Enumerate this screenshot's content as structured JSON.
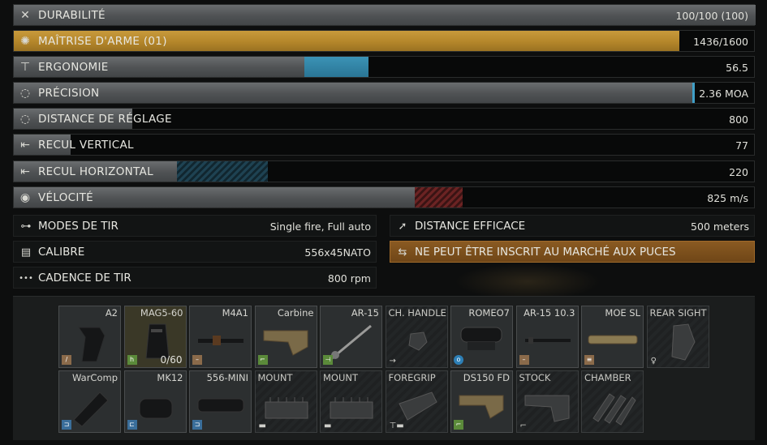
{
  "stats": [
    {
      "key": "durability",
      "icon": "wrench-icon",
      "glyph": "✕",
      "label": "DURABILITÉ",
      "value": "100/100 (100)",
      "fill": 1.0
    },
    {
      "key": "mastery",
      "icon": "laurel-icon",
      "glyph": "✺",
      "label": "MAÎTRISE D'ARME (01)",
      "value": "1436/1600",
      "fill": 0.8975
    },
    {
      "key": "ergonomics",
      "icon": "hand-icon",
      "glyph": "⊤",
      "label": "ERGONOMIE",
      "value": "56.5",
      "fill": 0.478,
      "delta": 0.086
    },
    {
      "key": "accuracy",
      "icon": "crosshair-icon",
      "glyph": "◌",
      "label": "PRÉCISION",
      "value": "2.36 MOA",
      "fill": 0.915
    },
    {
      "key": "sighting_range",
      "icon": "crosshair-icon",
      "glyph": "◌",
      "label": "DISTANCE DE RÉGLAGE",
      "value": "800",
      "fill": 0.16
    },
    {
      "key": "recoil_vertical",
      "icon": "recoil-icon",
      "glyph": "⇤",
      "label": "RECUL VERTICAL",
      "value": "77",
      "fill": 0.077
    },
    {
      "key": "recoil_horizontal",
      "icon": "recoil-icon",
      "glyph": "⇤",
      "label": "RECUL HORIZONTAL",
      "value": "220",
      "fill": 0.22,
      "delta_stripe": 0.122
    },
    {
      "key": "velocity",
      "icon": "muzzle-icon",
      "glyph": "◉",
      "label": "VÉLOCITÉ",
      "value": "825 m/s",
      "fill": 0.552,
      "delta_red": 0.065
    }
  ],
  "info": {
    "fire_modes": {
      "label": "MODES DE TIR",
      "value": "Single fire, Full auto",
      "glyph": "⊶"
    },
    "caliber": {
      "label": "CALIBRE",
      "value": "556x45NATO",
      "glyph": "▤"
    },
    "fire_rate": {
      "label": "CADENCE DE TIR",
      "value": "800 rpm",
      "glyph": "•••"
    },
    "effective_distance": {
      "label": "DISTANCE EFFICACE",
      "value": "500 meters",
      "glyph": "➚"
    },
    "flea_market": {
      "label": "NE PEUT ÊTRE INSCRIT AU MARCHÉ AUX PUCES",
      "glyph": "⇆"
    }
  },
  "mods_row1": [
    {
      "name": "A2",
      "badge": "brown",
      "btxt": "/"
    },
    {
      "name": "MAG5-60",
      "badge": "green",
      "btxt": "h",
      "count": "0/60",
      "tan": true
    },
    {
      "name": "M4A1",
      "badge": "brown",
      "btxt": "–"
    },
    {
      "name": "Carbine",
      "badge": "green",
      "btxt": "⌐"
    },
    {
      "name": "AR-15",
      "badge": "green",
      "btxt": "⊣"
    },
    {
      "name": "CH. HANDLE",
      "empty": true,
      "btxt": "→"
    },
    {
      "name": "ROMEO7",
      "badge": "sky",
      "btxt": "o"
    },
    {
      "name": "AR-15 10.3",
      "badge": "brown",
      "btxt": "–"
    },
    {
      "name": "MOE SL",
      "badge": "brown",
      "btxt": "≡"
    },
    {
      "name": "REAR SIGHT",
      "empty": true,
      "btxt": "♀"
    }
  ],
  "mods_row2": [
    {
      "name": "WarComp",
      "badge": "blue",
      "btxt": "⊐"
    },
    {
      "name": "MK12",
      "badge": "blue",
      "btxt": "⊏"
    },
    {
      "name": "556-MINI",
      "badge": "blue",
      "btxt": "⊐"
    },
    {
      "name": "MOUNT",
      "empty": true,
      "btxt": "▬"
    },
    {
      "name": "MOUNT",
      "empty": true,
      "btxt": "▬"
    },
    {
      "name": "FOREGRIP",
      "empty": true,
      "btxt": "⊤▬"
    },
    {
      "name": "DS150 FD",
      "badge": "green",
      "btxt": "⌐"
    },
    {
      "name": "STOCK",
      "empty": true,
      "btxt": "⌐"
    },
    {
      "name": "CHAMBER",
      "empty": true,
      "btxt": ""
    }
  ]
}
